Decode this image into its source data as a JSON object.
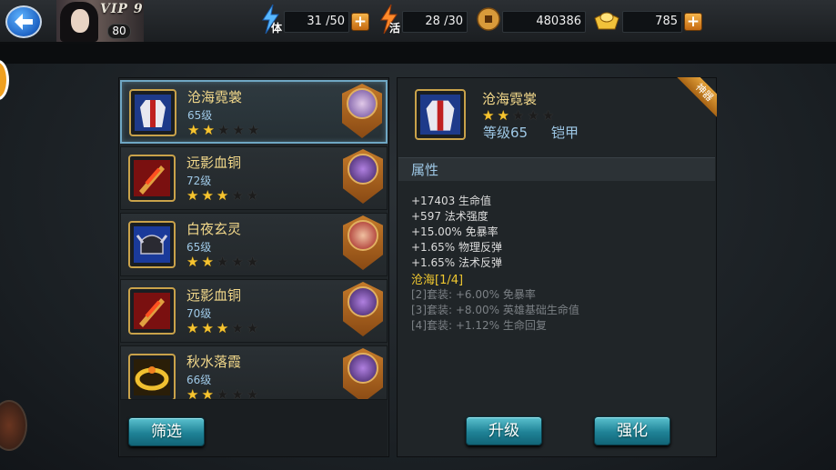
{
  "player": {
    "vip": "VIP 9",
    "level": "80"
  },
  "resources": {
    "stamina": {
      "tag": "体",
      "value": "31 /50"
    },
    "vitality": {
      "tag": "活",
      "value": "28 /30"
    },
    "coins": {
      "value": "480386"
    },
    "ingots": {
      "value": "785"
    },
    "plus": "+"
  },
  "equipment_list": [
    {
      "name": "沧海霓裳",
      "level": "65级",
      "stars": 2,
      "selected": true,
      "color": "#c9a24a"
    },
    {
      "name": "远影血铜",
      "level": "72级",
      "stars": 3,
      "selected": false,
      "color": "#c9a24a"
    },
    {
      "name": "白夜玄灵",
      "level": "65级",
      "stars": 2,
      "selected": false,
      "color": "#c9a24a"
    },
    {
      "name": "远影血铜",
      "level": "70级",
      "stars": 3,
      "selected": false,
      "color": "#c9a24a"
    },
    {
      "name": "秋水落霞",
      "level": "66级",
      "stars": 2,
      "selected": false,
      "color": "#c9a24a"
    }
  ],
  "buttons": {
    "filter": "筛选",
    "upgrade": "升级",
    "enhance": "强化"
  },
  "detail": {
    "name": "沧海霓裳",
    "stars": 2,
    "level": "等级65",
    "type": "铠甲",
    "ribbon": "神器",
    "attr_title": "属性",
    "attributes": [
      "+17403 生命值",
      "+597 法术强度",
      "+15.00% 免暴率",
      "+1.65% 物理反弹",
      "+1.65% 法术反弹"
    ],
    "set_name": "沧海[1/4]",
    "set_bonuses": [
      "[2]套装: +6.00% 免暴率",
      "[3]套装: +8.00% 英雄基础生命值",
      "[4]套装: +1.12% 生命回复"
    ]
  },
  "colors": {
    "accent_blue": "#9ec8e6",
    "gold_text": "#f2d88a",
    "set_yellow": "#f0c830",
    "button_teal": "#1f8296"
  }
}
